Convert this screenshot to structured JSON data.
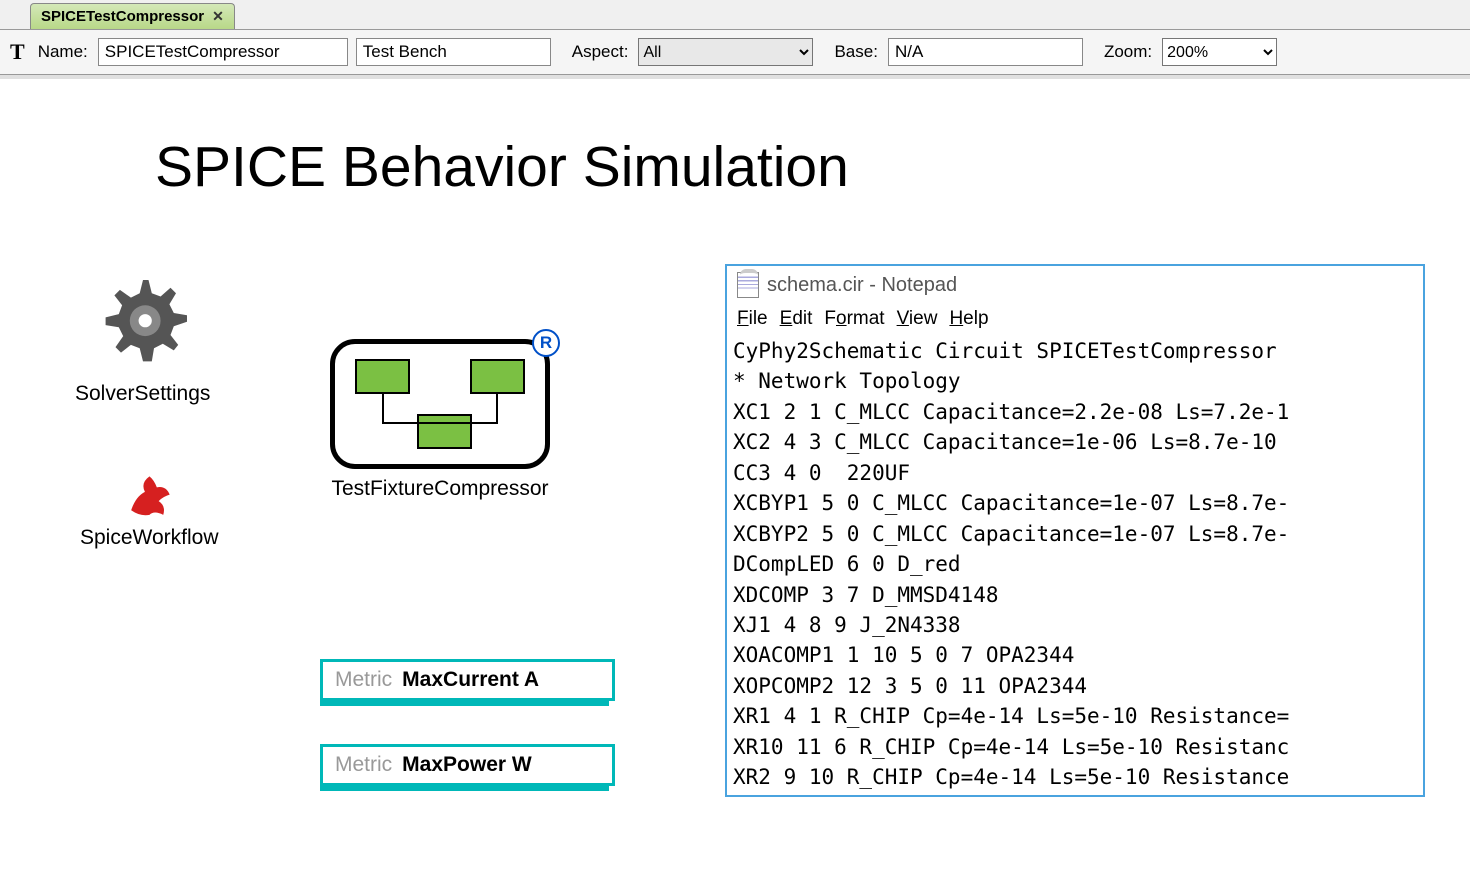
{
  "tab": {
    "title": "SPICETestCompressor"
  },
  "toolbar": {
    "name_label": "Name:",
    "name_value": "SPICETestCompressor",
    "type_value": "Test Bench",
    "aspect_label": "Aspect:",
    "aspect_value": "All",
    "base_label": "Base:",
    "base_value": "N/A",
    "zoom_label": "Zoom:",
    "zoom_value": "200%"
  },
  "canvas": {
    "title": "SPICE Behavior Simulation",
    "solver_settings": "SolverSettings",
    "spice_workflow": "SpiceWorkflow",
    "test_fixture": "TestFixtureCompressor",
    "metric_label": "Metric",
    "metric_1": "MaxCurrent A",
    "metric_2": "MaxPower W"
  },
  "notepad": {
    "title": "schema.cir - Notepad",
    "menu": {
      "file": "File",
      "edit": "Edit",
      "format": "Format",
      "view": "View",
      "help": "Help"
    },
    "content": "CyPhy2Schematic Circuit SPICETestCompressor\n* Network Topology\nXC1 2 1 C_MLCC Capacitance=2.2e-08 Ls=7.2e-1\nXC2 4 3 C_MLCC Capacitance=1e-06 Ls=8.7e-10\nCC3 4 0  220UF\nXCBYP1 5 0 C_MLCC Capacitance=1e-07 Ls=8.7e-\nXCBYP2 5 0 C_MLCC Capacitance=1e-07 Ls=8.7e-\nDCompLED 6 0 D_red\nXDCOMP 3 7 D_MMSD4148\nXJ1 4 8 9 J_2N4338\nXOACOMP1 1 10 5 0 7 OPA2344\nXOPCOMP2 12 3 5 0 11 OPA2344\nXR1 4 1 R_CHIP Cp=4e-14 Ls=5e-10 Resistance=\nXR10 11 6 R_CHIP Cp=4e-14 Ls=5e-10 Resistanc\nXR2 9 10 R_CHIP Cp=4e-14 Ls=5e-10 Resistance"
  }
}
